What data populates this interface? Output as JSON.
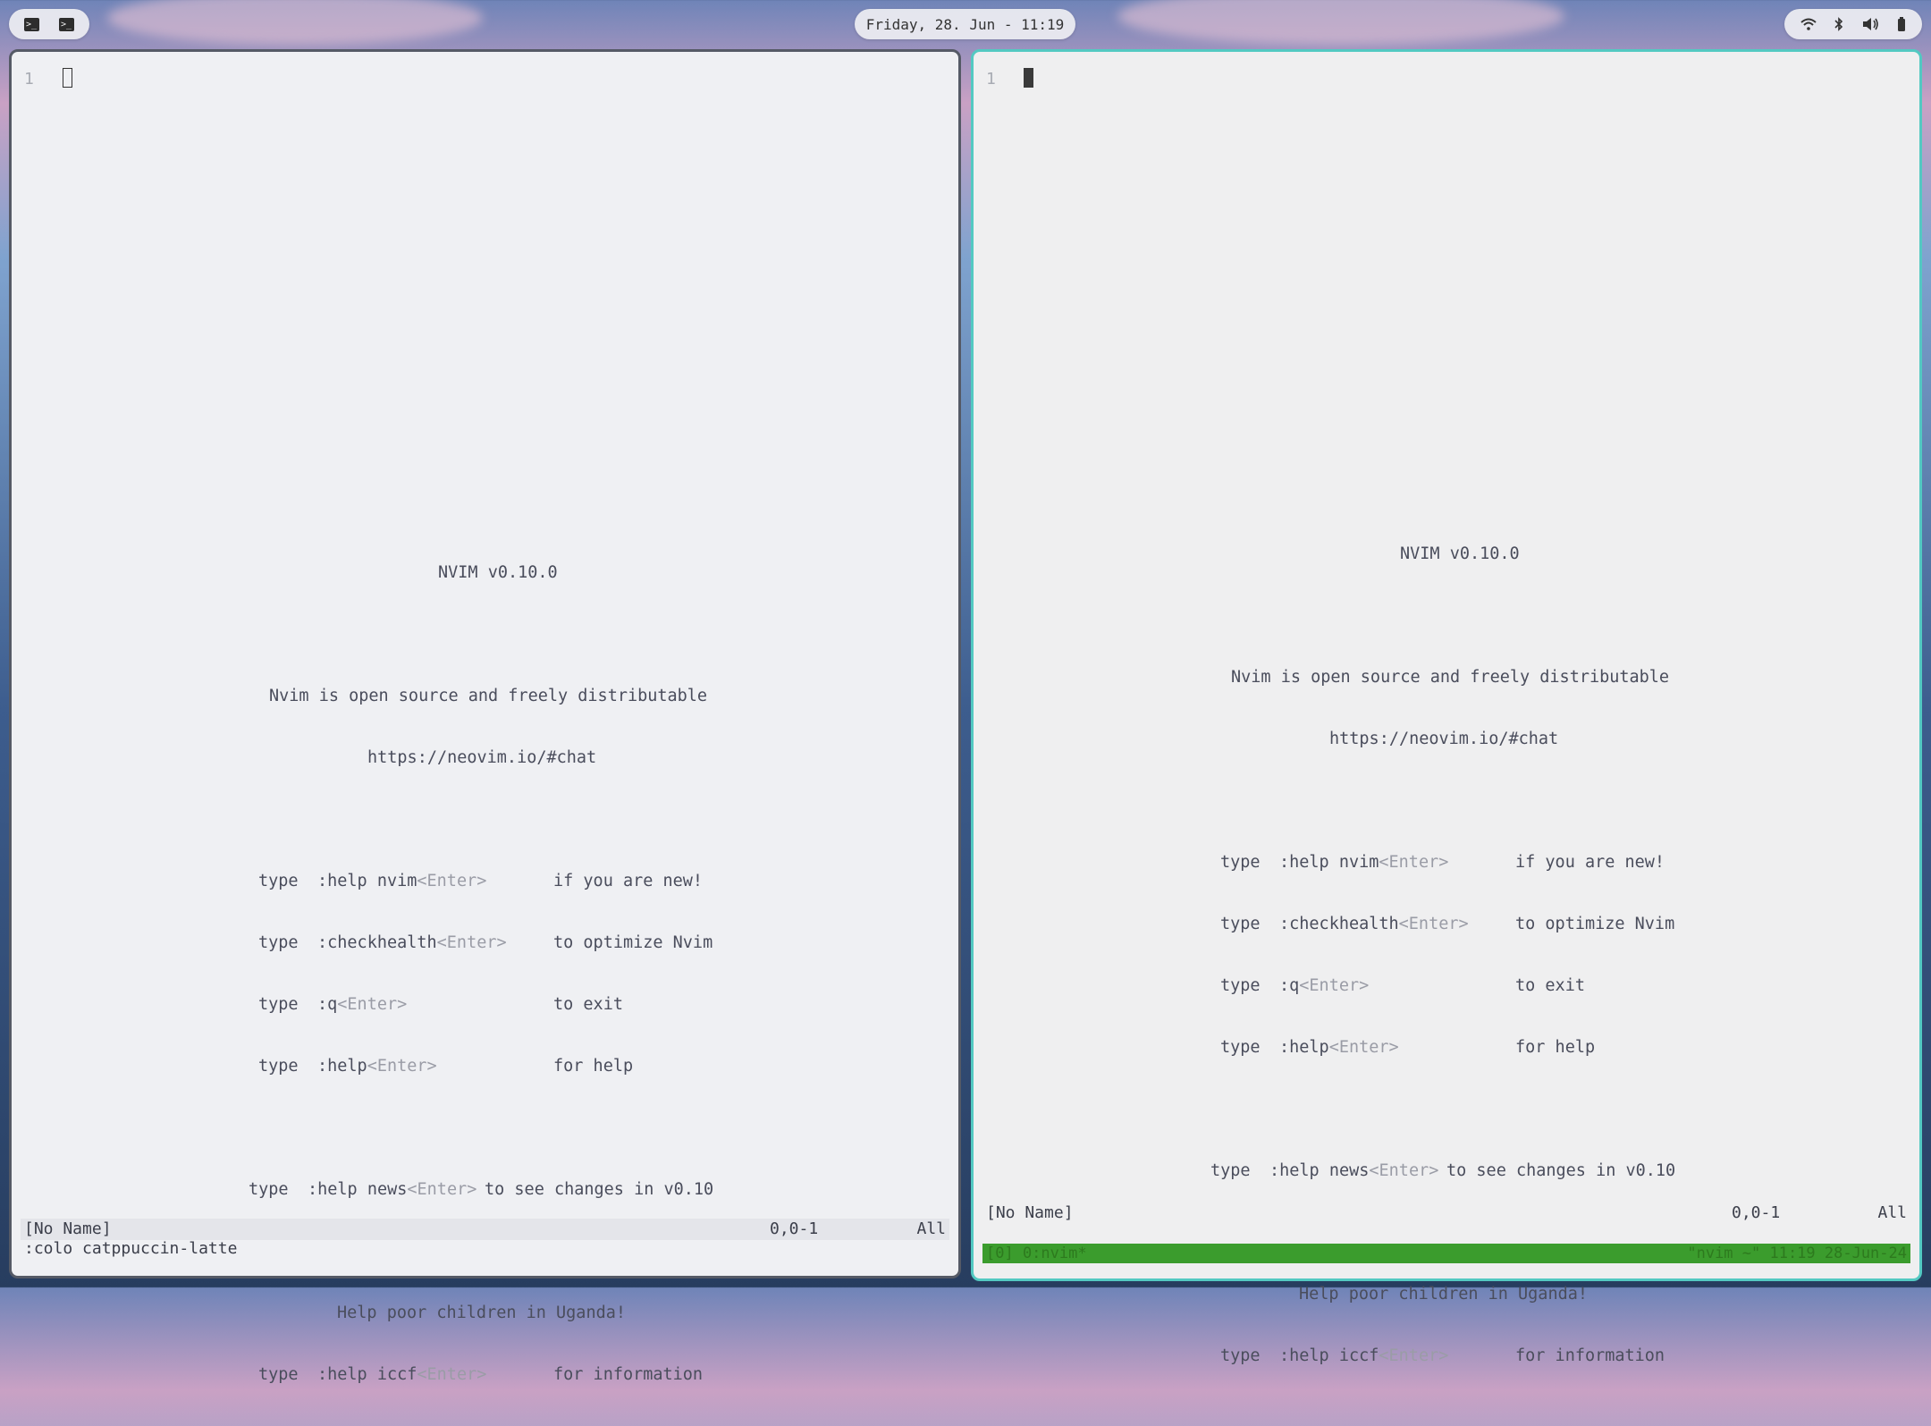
{
  "topbar": {
    "left_icons": [
      "terminal-icon",
      "terminal-icon"
    ],
    "clock": "Friday, 28. Jun - 11:19",
    "tray_icons": [
      "wifi-icon",
      "bluetooth-icon",
      "volume-icon",
      "battery-icon"
    ]
  },
  "left_pane": {
    "line_number": "1",
    "intro": {
      "title": "NVIM v0.10.0",
      "line1": "Nvim is open source and freely distributable",
      "line2": "https://neovim.io/#chat",
      "help_rows": [
        {
          "type": "type",
          "cmd": ":help nvim",
          "key": "<Enter>",
          "desc": "if you are new!"
        },
        {
          "type": "type",
          "cmd": ":checkhealth",
          "key": "<Enter>",
          "desc": "to optimize Nvim"
        },
        {
          "type": "type",
          "cmd": ":q",
          "key": "<Enter>",
          "desc": "to exit"
        },
        {
          "type": "type",
          "cmd": ":help",
          "key": "<Enter>",
          "desc": "for help"
        }
      ],
      "news": {
        "type": "type",
        "cmd": ":help news",
        "key": "<Enter>",
        "desc": "to see changes in v0.10"
      },
      "uganda": "Help poor children in Uganda!",
      "iccf": {
        "type": "type",
        "cmd": ":help iccf",
        "key": "<Enter>",
        "desc": "for information"
      }
    },
    "statusline": {
      "name": "[No Name]",
      "position": "0,0-1",
      "scroll": "All"
    },
    "cmdline": ":colo catppuccin-latte"
  },
  "right_pane": {
    "line_number": "1",
    "intro": {
      "title": "NVIM v0.10.0",
      "line1": "Nvim is open source and freely distributable",
      "line2": "https://neovim.io/#chat",
      "help_rows": [
        {
          "type": "type",
          "cmd": ":help nvim",
          "key": "<Enter>",
          "desc": "if you are new!"
        },
        {
          "type": "type",
          "cmd": ":checkhealth",
          "key": "<Enter>",
          "desc": "to optimize Nvim"
        },
        {
          "type": "type",
          "cmd": ":q",
          "key": "<Enter>",
          "desc": "to exit"
        },
        {
          "type": "type",
          "cmd": ":help",
          "key": "<Enter>",
          "desc": "for help"
        }
      ],
      "news": {
        "type": "type",
        "cmd": ":help news",
        "key": "<Enter>",
        "desc": "to see changes in v0.10"
      },
      "uganda": "Help poor children in Uganda!",
      "iccf": {
        "type": "type",
        "cmd": ":help iccf",
        "key": "<Enter>",
        "desc": "for information"
      }
    },
    "statusline": {
      "name": "[No Name]",
      "position": "0,0-1",
      "scroll": "All"
    },
    "tmux": {
      "left": "[0] 0:nvim*",
      "right": "\"nvim ~\" 11:19 28-Jun-24"
    }
  },
  "colors": {
    "tmux_bar": "#3b9c2d",
    "active_border": "#53c9c2",
    "inactive_border": "#555a66"
  }
}
